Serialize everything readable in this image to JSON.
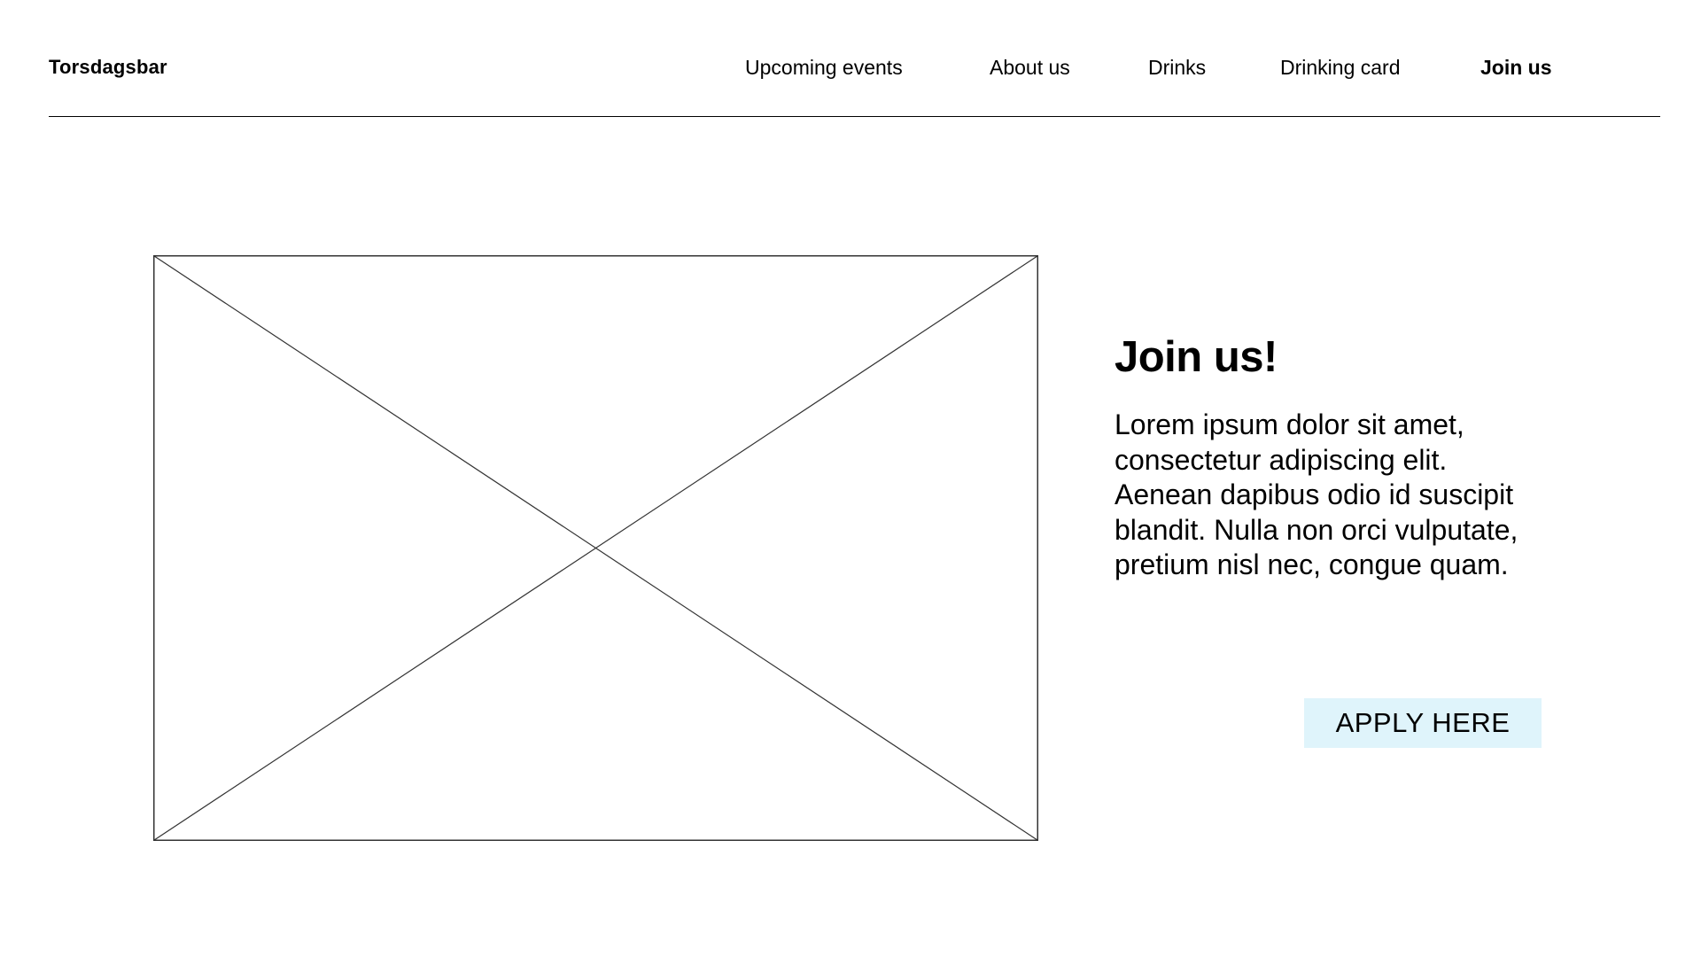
{
  "header": {
    "brand": "Torsdagsbar",
    "nav": [
      {
        "label": "Upcoming events",
        "active": false
      },
      {
        "label": "About us",
        "active": false
      },
      {
        "label": "Drinks",
        "active": false
      },
      {
        "label": "Drinking card",
        "active": false
      },
      {
        "label": "Join us",
        "active": true
      }
    ]
  },
  "hero": {
    "image_placeholder_icon": "image-placeholder-icon"
  },
  "content": {
    "heading": "Join us!",
    "body": "Lorem ipsum dolor sit amet, consectetur adipiscing elit. Aenean dapibus odio id suscipit blandit. Nulla non orci vulputate, pretium nisl nec, congue quam.",
    "button_label": "APPLY HERE"
  },
  "colors": {
    "background": "#ffffff",
    "text": "#000000",
    "button_background": "#dff4fb",
    "divider": "#000000"
  }
}
